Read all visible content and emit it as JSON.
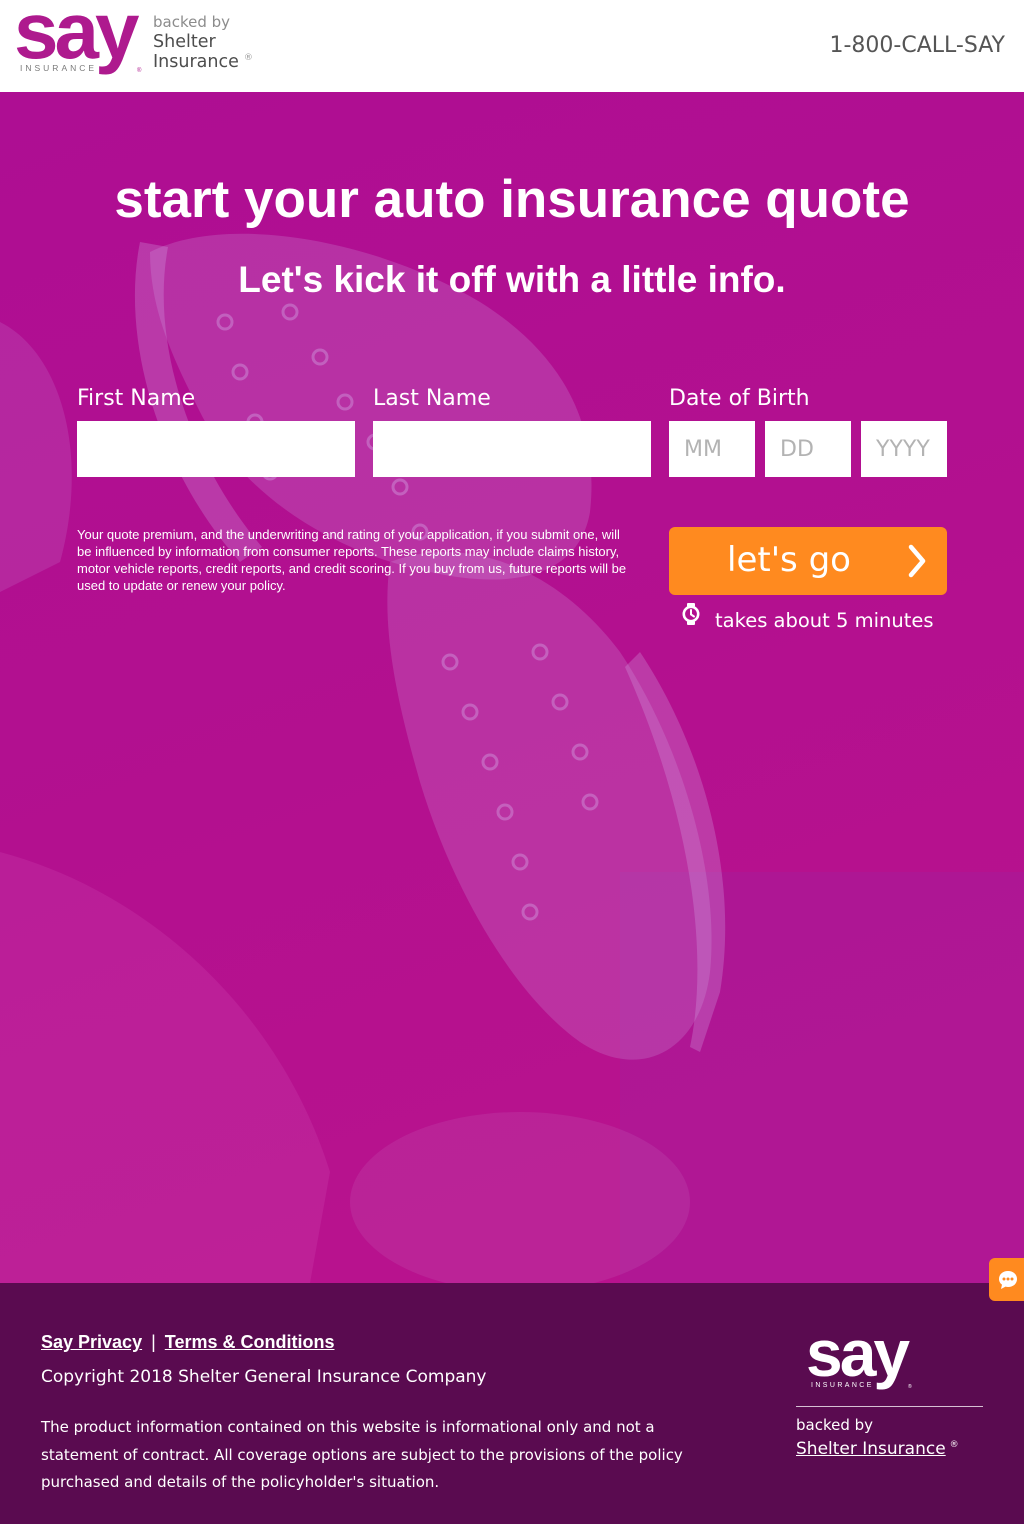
{
  "colors": {
    "brand_magenta": "#ae1a8e",
    "hero_bg": "#b10e92",
    "cta_orange": "#ff8a1f",
    "footer_bg": "#5a0b50",
    "header_text": "#555555"
  },
  "header": {
    "logo": {
      "wordmark": "say",
      "tagline": "INSURANCE",
      "registered": "®"
    },
    "backed_by": "backed by",
    "partner_line1": "Shelter",
    "partner_line2": "Insurance",
    "partner_registered": "®",
    "phone": "1-800-CALL-SAY"
  },
  "hero": {
    "title": "start your auto insurance quote",
    "subtitle": "Let's kick it off with a little info."
  },
  "form": {
    "first_name": {
      "label": "First Name",
      "value": ""
    },
    "last_name": {
      "label": "Last Name",
      "value": ""
    },
    "dob": {
      "label": "Date of Birth",
      "month_placeholder": "MM",
      "day_placeholder": "DD",
      "year_placeholder": "YYYY"
    },
    "disclaimer": "Your quote premium, and the underwriting and rating of your application, if you submit one, will be influenced by information from consumer reports. These reports may include claims history, motor vehicle reports, credit reports, and credit scoring. If you buy from us, future reports will be used to update or renew your policy."
  },
  "cta": {
    "label": "let's go",
    "icon": "chevron-right-icon",
    "time_icon": "stopwatch-icon",
    "time_note": "takes about 5 minutes"
  },
  "chat_widget": {
    "icon": "chat-bubble-icon"
  },
  "footer": {
    "links": [
      {
        "label": "Say Privacy"
      },
      {
        "label": "Terms & Conditions"
      }
    ],
    "link_separator": "|",
    "copyright": "Copyright 2018 Shelter General Insurance Company",
    "notice": "The product information contained on this website is informational only and not a statement of contract. All coverage options are subject to the provisions of the policy purchased and details of the policyholder's situation.",
    "logo": {
      "wordmark": "say",
      "tagline": "INSURANCE",
      "registered": "®"
    },
    "backed_by": "backed by",
    "partner_link": "Shelter Insurance",
    "partner_registered": "®"
  }
}
